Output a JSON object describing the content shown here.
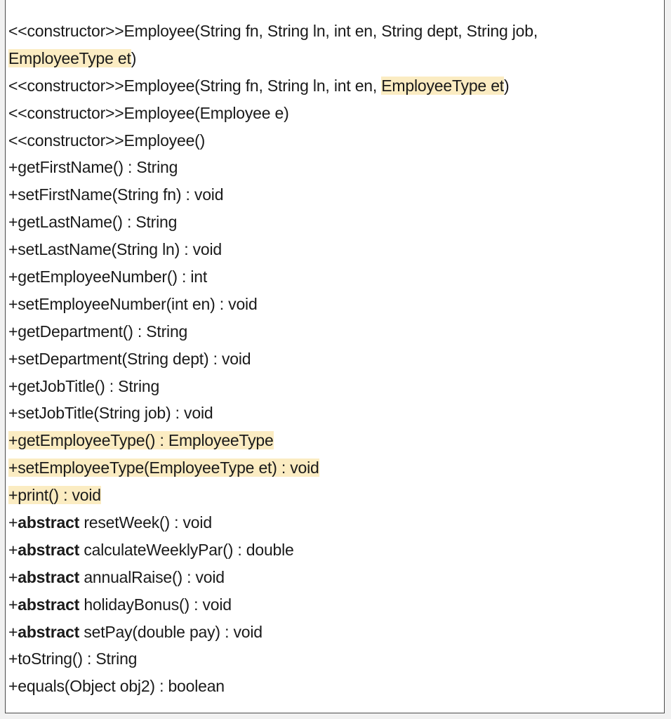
{
  "methods": [
    {
      "segments": [
        {
          "text": "<<constructor>>Employee(String fn, String ln, int en, String dept, String job,",
          "hl": false,
          "bold": false
        }
      ]
    },
    {
      "segments": [
        {
          "text": "EmployeeType et",
          "hl": true,
          "bold": false
        },
        {
          "text": ")",
          "hl": false,
          "bold": false
        }
      ]
    },
    {
      "segments": [
        {
          "text": "<<constructor>>Employee(String fn, String ln, int en, ",
          "hl": false,
          "bold": false
        },
        {
          "text": "EmployeeType et",
          "hl": true,
          "bold": false
        },
        {
          "text": ")",
          "hl": false,
          "bold": false
        }
      ]
    },
    {
      "segments": [
        {
          "text": "<<constructor>>Employee(Employee e)",
          "hl": false,
          "bold": false
        }
      ]
    },
    {
      "segments": [
        {
          "text": "<<constructor>>Employee()",
          "hl": false,
          "bold": false
        }
      ]
    },
    {
      "segments": [
        {
          "text": "+getFirstName() : String",
          "hl": false,
          "bold": false
        }
      ]
    },
    {
      "segments": [
        {
          "text": "+setFirstName(String fn) : void",
          "hl": false,
          "bold": false
        }
      ]
    },
    {
      "segments": [
        {
          "text": "+getLastName() : String",
          "hl": false,
          "bold": false
        }
      ]
    },
    {
      "segments": [
        {
          "text": "+setLastName(String ln) : void",
          "hl": false,
          "bold": false
        }
      ]
    },
    {
      "segments": [
        {
          "text": "+getEmployeeNumber() : int",
          "hl": false,
          "bold": false
        }
      ]
    },
    {
      "segments": [
        {
          "text": "+setEmployeeNumber(int en) : void",
          "hl": false,
          "bold": false
        }
      ]
    },
    {
      "segments": [
        {
          "text": "+getDepartment() : String",
          "hl": false,
          "bold": false
        }
      ]
    },
    {
      "segments": [
        {
          "text": "+setDepartment(String dept) : void",
          "hl": false,
          "bold": false
        }
      ]
    },
    {
      "segments": [
        {
          "text": "+getJobTitle() : String",
          "hl": false,
          "bold": false
        }
      ]
    },
    {
      "segments": [
        {
          "text": "+setJobTitle(String job) : void",
          "hl": false,
          "bold": false
        }
      ]
    },
    {
      "segments": [
        {
          "text": "+getEmployeeType() : EmployeeType",
          "hl": true,
          "bold": false
        }
      ]
    },
    {
      "segments": [
        {
          "text": "+setEmployeeType(EmployeeType et) : void",
          "hl": true,
          "bold": false
        }
      ]
    },
    {
      "segments": [
        {
          "text": "+print() : void",
          "hl": true,
          "bold": false
        }
      ]
    },
    {
      "segments": [
        {
          "text": "+",
          "hl": false,
          "bold": false
        },
        {
          "text": "abstract",
          "hl": false,
          "bold": true
        },
        {
          "text": " resetWeek() : void",
          "hl": false,
          "bold": false
        }
      ]
    },
    {
      "segments": [
        {
          "text": "+",
          "hl": false,
          "bold": false
        },
        {
          "text": "abstract",
          "hl": false,
          "bold": true
        },
        {
          "text": " calculateWeeklyPar() : double",
          "hl": false,
          "bold": false
        }
      ]
    },
    {
      "segments": [
        {
          "text": "+",
          "hl": false,
          "bold": false
        },
        {
          "text": "abstract",
          "hl": false,
          "bold": true
        },
        {
          "text": " annualRaise() : void",
          "hl": false,
          "bold": false
        }
      ]
    },
    {
      "segments": [
        {
          "text": "+",
          "hl": false,
          "bold": false
        },
        {
          "text": "abstract",
          "hl": false,
          "bold": true
        },
        {
          "text": " holidayBonus() : void",
          "hl": false,
          "bold": false
        }
      ]
    },
    {
      "segments": [
        {
          "text": "+",
          "hl": false,
          "bold": false
        },
        {
          "text": "abstract",
          "hl": false,
          "bold": true
        },
        {
          "text": " setPay(double pay) : void",
          "hl": false,
          "bold": false
        }
      ]
    },
    {
      "segments": [
        {
          "text": "+toString() : String",
          "hl": false,
          "bold": false
        }
      ]
    },
    {
      "segments": [
        {
          "text": "+equals(Object obj2) : boolean",
          "hl": false,
          "bold": false
        }
      ]
    }
  ],
  "colors": {
    "highlight": "#fbecc2",
    "text": "#1a1a1a",
    "border": "#4a4a4a"
  }
}
